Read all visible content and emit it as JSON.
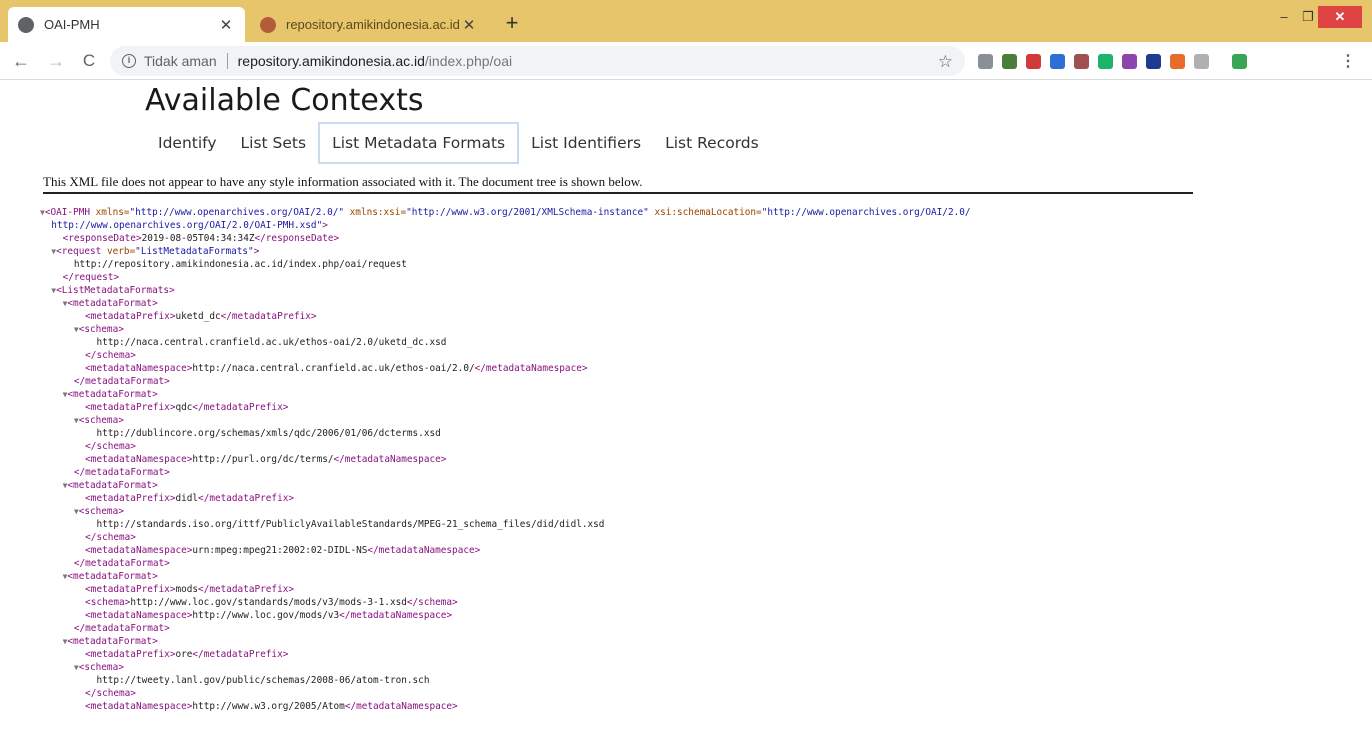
{
  "browser": {
    "tabs": [
      {
        "title": "OAI-PMH",
        "active": true
      },
      {
        "title": "repository.amikindonesia.ac.id/in",
        "active": false
      }
    ],
    "new_tab": "+",
    "window_controls": {
      "minimize": "–",
      "maximize": "❐",
      "close": "✕"
    },
    "nav": {
      "back": "←",
      "forward": "→",
      "reload": "C"
    },
    "omnibox": {
      "security_label": "Tidak aman",
      "url_host": "repository.amikindonesia.ac.id",
      "url_path": "/index.php/oai"
    },
    "extensions": [
      {
        "icon": "extension-icon",
        "color": "#8a8f98"
      },
      {
        "icon": "extension-icon",
        "color": "#4a7d3c"
      },
      {
        "icon": "extension-icon",
        "color": "#d23a3a"
      },
      {
        "icon": "extension-icon",
        "color": "#2d6fd6"
      },
      {
        "icon": "extension-icon",
        "color": "#a05050"
      },
      {
        "icon": "extension-icon",
        "color": "#1db36a"
      },
      {
        "icon": "extension-icon",
        "color": "#8e44ad"
      },
      {
        "icon": "extension-icon",
        "color": "#1f3b8f"
      },
      {
        "icon": "extension-icon",
        "color": "#e96b2a"
      },
      {
        "icon": "extension-icon",
        "color": "#b0b0b0"
      },
      {
        "icon": "extension-icon",
        "color": "#3aa655"
      }
    ]
  },
  "page": {
    "title": "Available Contexts",
    "tabs": [
      "Identify",
      "List Sets",
      "List Metadata Formats",
      "List Identifiers",
      "List Records"
    ],
    "active_tab": "List Metadata Formats",
    "xml_notice": "This XML file does not appear to have any style information associated with it. The document tree is shown below.",
    "xml_lines": [
      {
        "indent": 0,
        "tri": "▼",
        "parts": [
          [
            "tag",
            "<OAI-PMH "
          ],
          [
            "attr",
            "xmlns="
          ],
          [
            "val",
            "\"http://www.openarchives.org/OAI/2.0/\""
          ],
          [
            "attr",
            " xmlns:xsi="
          ],
          [
            "val",
            "\"http://www.w3.org/2001/XMLSchema-instance\""
          ],
          [
            "attr",
            " xsi:schemaLocation="
          ],
          [
            "val",
            "\"http://www.openarchives.org/OAI/2.0/"
          ]
        ]
      },
      {
        "indent": 1,
        "tri": "",
        "parts": [
          [
            "val",
            "http://www.openarchives.org/OAI/2.0/OAI-PMH.xsd\""
          ],
          [
            "tag",
            ">"
          ]
        ]
      },
      {
        "indent": 2,
        "tri": "",
        "parts": [
          [
            "tag",
            "<responseDate>"
          ],
          [
            "text",
            "2019-08-05T04:34:34Z"
          ],
          [
            "tag",
            "</responseDate>"
          ]
        ]
      },
      {
        "indent": 1,
        "tri": "▼",
        "parts": [
          [
            "tag",
            "<request "
          ],
          [
            "attr",
            "verb="
          ],
          [
            "val",
            "\"ListMetadataFormats\""
          ],
          [
            "tag",
            ">"
          ]
        ]
      },
      {
        "indent": 3,
        "tri": "",
        "parts": [
          [
            "text",
            "http://repository.amikindonesia.ac.id/index.php/oai/request"
          ]
        ]
      },
      {
        "indent": 2,
        "tri": "",
        "parts": [
          [
            "tag",
            "</request>"
          ]
        ]
      },
      {
        "indent": 1,
        "tri": "▼",
        "parts": [
          [
            "tag",
            "<ListMetadataFormats>"
          ]
        ]
      },
      {
        "indent": 2,
        "tri": "▼",
        "parts": [
          [
            "tag",
            "<metadataFormat>"
          ]
        ]
      },
      {
        "indent": 4,
        "tri": "",
        "parts": [
          [
            "tag",
            "<metadataPrefix>"
          ],
          [
            "text",
            "uketd_dc"
          ],
          [
            "tag",
            "</metadataPrefix>"
          ]
        ]
      },
      {
        "indent": 3,
        "tri": "▼",
        "parts": [
          [
            "tag",
            "<schema>"
          ]
        ]
      },
      {
        "indent": 5,
        "tri": "",
        "parts": [
          [
            "text",
            "http://naca.central.cranfield.ac.uk/ethos-oai/2.0/uketd_dc.xsd"
          ]
        ]
      },
      {
        "indent": 4,
        "tri": "",
        "parts": [
          [
            "tag",
            "</schema>"
          ]
        ]
      },
      {
        "indent": 4,
        "tri": "",
        "parts": [
          [
            "tag",
            "<metadataNamespace>"
          ],
          [
            "text",
            "http://naca.central.cranfield.ac.uk/ethos-oai/2.0/"
          ],
          [
            "tag",
            "</metadataNamespace>"
          ]
        ]
      },
      {
        "indent": 3,
        "tri": "",
        "parts": [
          [
            "tag",
            "</metadataFormat>"
          ]
        ]
      },
      {
        "indent": 2,
        "tri": "▼",
        "parts": [
          [
            "tag",
            "<metadataFormat>"
          ]
        ]
      },
      {
        "indent": 4,
        "tri": "",
        "parts": [
          [
            "tag",
            "<metadataPrefix>"
          ],
          [
            "text",
            "qdc"
          ],
          [
            "tag",
            "</metadataPrefix>"
          ]
        ]
      },
      {
        "indent": 3,
        "tri": "▼",
        "parts": [
          [
            "tag",
            "<schema>"
          ]
        ]
      },
      {
        "indent": 5,
        "tri": "",
        "parts": [
          [
            "text",
            "http://dublincore.org/schemas/xmls/qdc/2006/01/06/dcterms.xsd"
          ]
        ]
      },
      {
        "indent": 4,
        "tri": "",
        "parts": [
          [
            "tag",
            "</schema>"
          ]
        ]
      },
      {
        "indent": 4,
        "tri": "",
        "parts": [
          [
            "tag",
            "<metadataNamespace>"
          ],
          [
            "text",
            "http://purl.org/dc/terms/"
          ],
          [
            "tag",
            "</metadataNamespace>"
          ]
        ]
      },
      {
        "indent": 3,
        "tri": "",
        "parts": [
          [
            "tag",
            "</metadataFormat>"
          ]
        ]
      },
      {
        "indent": 2,
        "tri": "▼",
        "parts": [
          [
            "tag",
            "<metadataFormat>"
          ]
        ]
      },
      {
        "indent": 4,
        "tri": "",
        "parts": [
          [
            "tag",
            "<metadataPrefix>"
          ],
          [
            "text",
            "didl"
          ],
          [
            "tag",
            "</metadataPrefix>"
          ]
        ]
      },
      {
        "indent": 3,
        "tri": "▼",
        "parts": [
          [
            "tag",
            "<schema>"
          ]
        ]
      },
      {
        "indent": 5,
        "tri": "",
        "parts": [
          [
            "text",
            "http://standards.iso.org/ittf/PubliclyAvailableStandards/MPEG-21_schema_files/did/didl.xsd"
          ]
        ]
      },
      {
        "indent": 4,
        "tri": "",
        "parts": [
          [
            "tag",
            "</schema>"
          ]
        ]
      },
      {
        "indent": 4,
        "tri": "",
        "parts": [
          [
            "tag",
            "<metadataNamespace>"
          ],
          [
            "text",
            "urn:mpeg:mpeg21:2002:02-DIDL-NS"
          ],
          [
            "tag",
            "</metadataNamespace>"
          ]
        ]
      },
      {
        "indent": 3,
        "tri": "",
        "parts": [
          [
            "tag",
            "</metadataFormat>"
          ]
        ]
      },
      {
        "indent": 2,
        "tri": "▼",
        "parts": [
          [
            "tag",
            "<metadataFormat>"
          ]
        ]
      },
      {
        "indent": 4,
        "tri": "",
        "parts": [
          [
            "tag",
            "<metadataPrefix>"
          ],
          [
            "text",
            "mods"
          ],
          [
            "tag",
            "</metadataPrefix>"
          ]
        ]
      },
      {
        "indent": 4,
        "tri": "",
        "parts": [
          [
            "tag",
            "<schema>"
          ],
          [
            "text",
            "http://www.loc.gov/standards/mods/v3/mods-3-1.xsd"
          ],
          [
            "tag",
            "</schema>"
          ]
        ]
      },
      {
        "indent": 4,
        "tri": "",
        "parts": [
          [
            "tag",
            "<metadataNamespace>"
          ],
          [
            "text",
            "http://www.loc.gov/mods/v3"
          ],
          [
            "tag",
            "</metadataNamespace>"
          ]
        ]
      },
      {
        "indent": 3,
        "tri": "",
        "parts": [
          [
            "tag",
            "</metadataFormat>"
          ]
        ]
      },
      {
        "indent": 2,
        "tri": "▼",
        "parts": [
          [
            "tag",
            "<metadataFormat>"
          ]
        ]
      },
      {
        "indent": 4,
        "tri": "",
        "parts": [
          [
            "tag",
            "<metadataPrefix>"
          ],
          [
            "text",
            "ore"
          ],
          [
            "tag",
            "</metadataPrefix>"
          ]
        ]
      },
      {
        "indent": 3,
        "tri": "▼",
        "parts": [
          [
            "tag",
            "<schema>"
          ]
        ]
      },
      {
        "indent": 5,
        "tri": "",
        "parts": [
          [
            "text",
            "http://tweety.lanl.gov/public/schemas/2008-06/atom-tron.sch"
          ]
        ]
      },
      {
        "indent": 4,
        "tri": "",
        "parts": [
          [
            "tag",
            "</schema>"
          ]
        ]
      },
      {
        "indent": 4,
        "tri": "",
        "parts": [
          [
            "tag",
            "<metadataNamespace>"
          ],
          [
            "text",
            "http://www.w3.org/2005/Atom"
          ],
          [
            "tag",
            "</metadataNamespace>"
          ]
        ]
      }
    ]
  }
}
